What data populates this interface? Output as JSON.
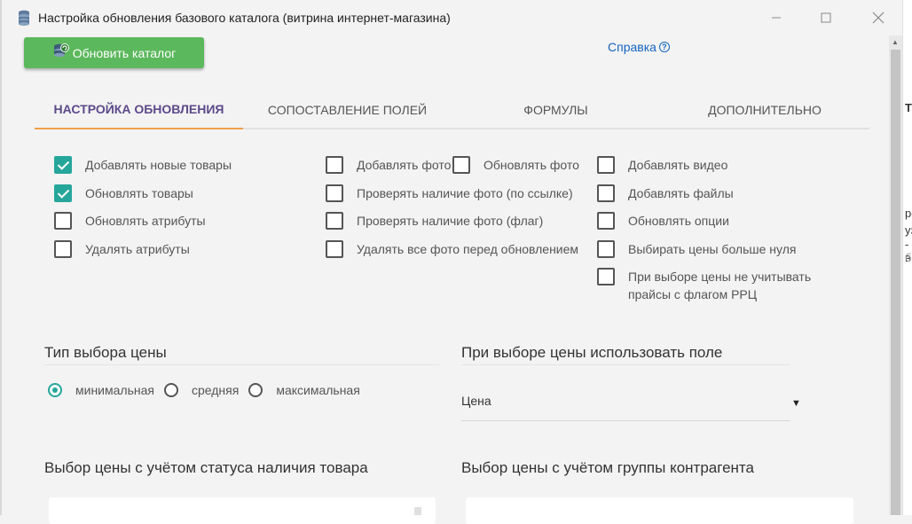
{
  "window": {
    "title": "Настройка обновления базового каталога (витрина интернет-магазина)",
    "icon": "database-icon"
  },
  "toolbar": {
    "update_label": "Обновить каталог",
    "help_label": "Справка"
  },
  "tabs": [
    {
      "label": "НАСТРОЙКА ОБНОВЛЕНИЯ",
      "active": true
    },
    {
      "label": "СОПОСТАВЛЕНИЕ ПОЛЕЙ",
      "active": false
    },
    {
      "label": "ФОРМУЛЫ",
      "active": false
    },
    {
      "label": "ДОПОЛНИТЕЛЬНО",
      "active": false
    }
  ],
  "options": {
    "col1": [
      {
        "label": "Добавлять новые товары",
        "checked": true
      },
      {
        "label": "Обновлять товары",
        "checked": true
      },
      {
        "label": "Обновлять атрибуты",
        "checked": false
      },
      {
        "label": "Удалять атрибуты",
        "checked": false
      }
    ],
    "col2": [
      {
        "label": "Добавлять фото",
        "checked": false
      },
      {
        "label": "Проверять наличие фото (по ссылке)",
        "checked": false
      },
      {
        "label": "Проверять наличие фото (флаг)",
        "checked": false
      },
      {
        "label": "Удалять все фото перед обновлением",
        "checked": false
      }
    ],
    "col2b": [
      {
        "label": "Обновлять фото",
        "checked": false
      }
    ],
    "col3": [
      {
        "label": "Добавлять видео",
        "checked": false
      },
      {
        "label": "Добавлять файлы",
        "checked": false
      },
      {
        "label": "Обновлять опции",
        "checked": false
      },
      {
        "label": "Выбирать цены больше нуля",
        "checked": false
      },
      {
        "label": "При выборе цены не учитывать прайсы с флагом РРЦ",
        "checked": false
      }
    ]
  },
  "price_type": {
    "title": "Тип выбора цены",
    "options": [
      {
        "label": "минимальная",
        "selected": true
      },
      {
        "label": "средняя",
        "selected": false
      },
      {
        "label": "максимальная",
        "selected": false
      }
    ]
  },
  "price_field": {
    "title": "При выборе цены использовать поле",
    "value": "Цена"
  },
  "stock_status": {
    "title": "Выбор цены с учётом статуса наличия товара"
  },
  "contractor_group": {
    "title": "Выбор цены с учётом группы контрагента"
  },
  "background_window": {
    "fragments": [
      "T",
      "ре",
      "уз",
      "- в",
      "бн"
    ]
  },
  "colors": {
    "accent": "#26a69a",
    "button": "#5cb85c",
    "tab_active": "#5c4a8a",
    "tab_indicator": "#f0a04b",
    "link": "#1565c0"
  }
}
